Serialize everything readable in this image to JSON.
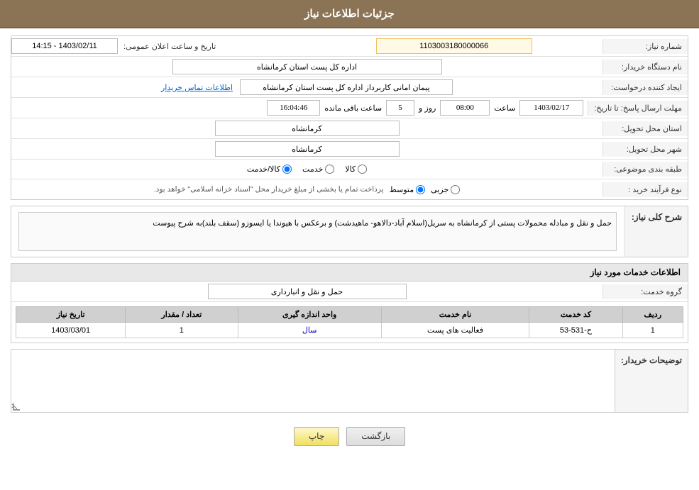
{
  "header": {
    "title": "جزئیات اطلاعات نیاز"
  },
  "fields": {
    "need_number_label": "شماره نیاز:",
    "need_number_value": "1103003180000066",
    "buyer_org_label": "نام دستگاه خریدار:",
    "buyer_org_value": "اداره کل پست استان کرمانشاه",
    "announcement_datetime_label": "تاریخ و ساعت اعلان عمومی:",
    "announcement_datetime_value": "1403/02/11 - 14:15",
    "creator_label": "ایجاد کننده درخواست:",
    "creator_value": "پیمان امانی کاربرداز اداره کل پست استان کرمانشاه",
    "contact_info_link": "اطلاعات تماس خریدار",
    "response_deadline_label": "مهلت ارسال پاسخ: تا تاریخ:",
    "response_date": "1403/02/17",
    "response_time_label": "ساعت",
    "response_time": "08:00",
    "response_days_label": "روز و",
    "response_days": "5",
    "countdown_label": "ساعت باقی مانده",
    "countdown_value": "16:04:46",
    "province_label": "استان محل تحویل:",
    "province_value": "کرمانشاه",
    "city_label": "شهر محل تحویل:",
    "city_value": "کرمانشاه",
    "category_label": "طبقه بندی موضوعی:",
    "cat_radio1": "کالا",
    "cat_radio2": "خدمت",
    "cat_radio3": "کالا/خدمت",
    "process_label": "نوع فرآیند خرید :",
    "process_radio1": "جزیی",
    "process_radio2": "متوسط",
    "process_note": "پرداخت تمام یا بخشی از مبلغ خریدار محل \"اسناد خزانه اسلامی\" خواهد بود.",
    "description_label": "شرح کلی نیاز:",
    "description_value": "حمل و نقل و مبادله محمولات پستی  از کرمانشاه به سریل(اسلام آباد-دالاهو-  ماهیدشت) و برعکس با هیوندا یا ایسوزو (سقف بلند)به شرح پیوست",
    "services_section_label": "اطلاعات خدمات مورد نیاز",
    "service_group_label": "گروه خدمت:",
    "service_group_value": "حمل و نقل و انبارداری",
    "table": {
      "col_row": "ردیف",
      "col_code": "کد خدمت",
      "col_name": "نام خدمت",
      "col_unit": "واحد اندازه گیری",
      "col_qty": "تعداد / مقدار",
      "col_date": "تاریخ نیاز",
      "rows": [
        {
          "row": "1",
          "code": "ح-531-53",
          "name": "فعالیت های پست",
          "unit": "سال",
          "qty": "1",
          "date": "1403/03/01"
        }
      ]
    },
    "buyer_notes_label": "توضیحات خریدار:",
    "buyer_notes_value": ""
  },
  "buttons": {
    "back_label": "بازگشت",
    "print_label": "چاپ"
  }
}
